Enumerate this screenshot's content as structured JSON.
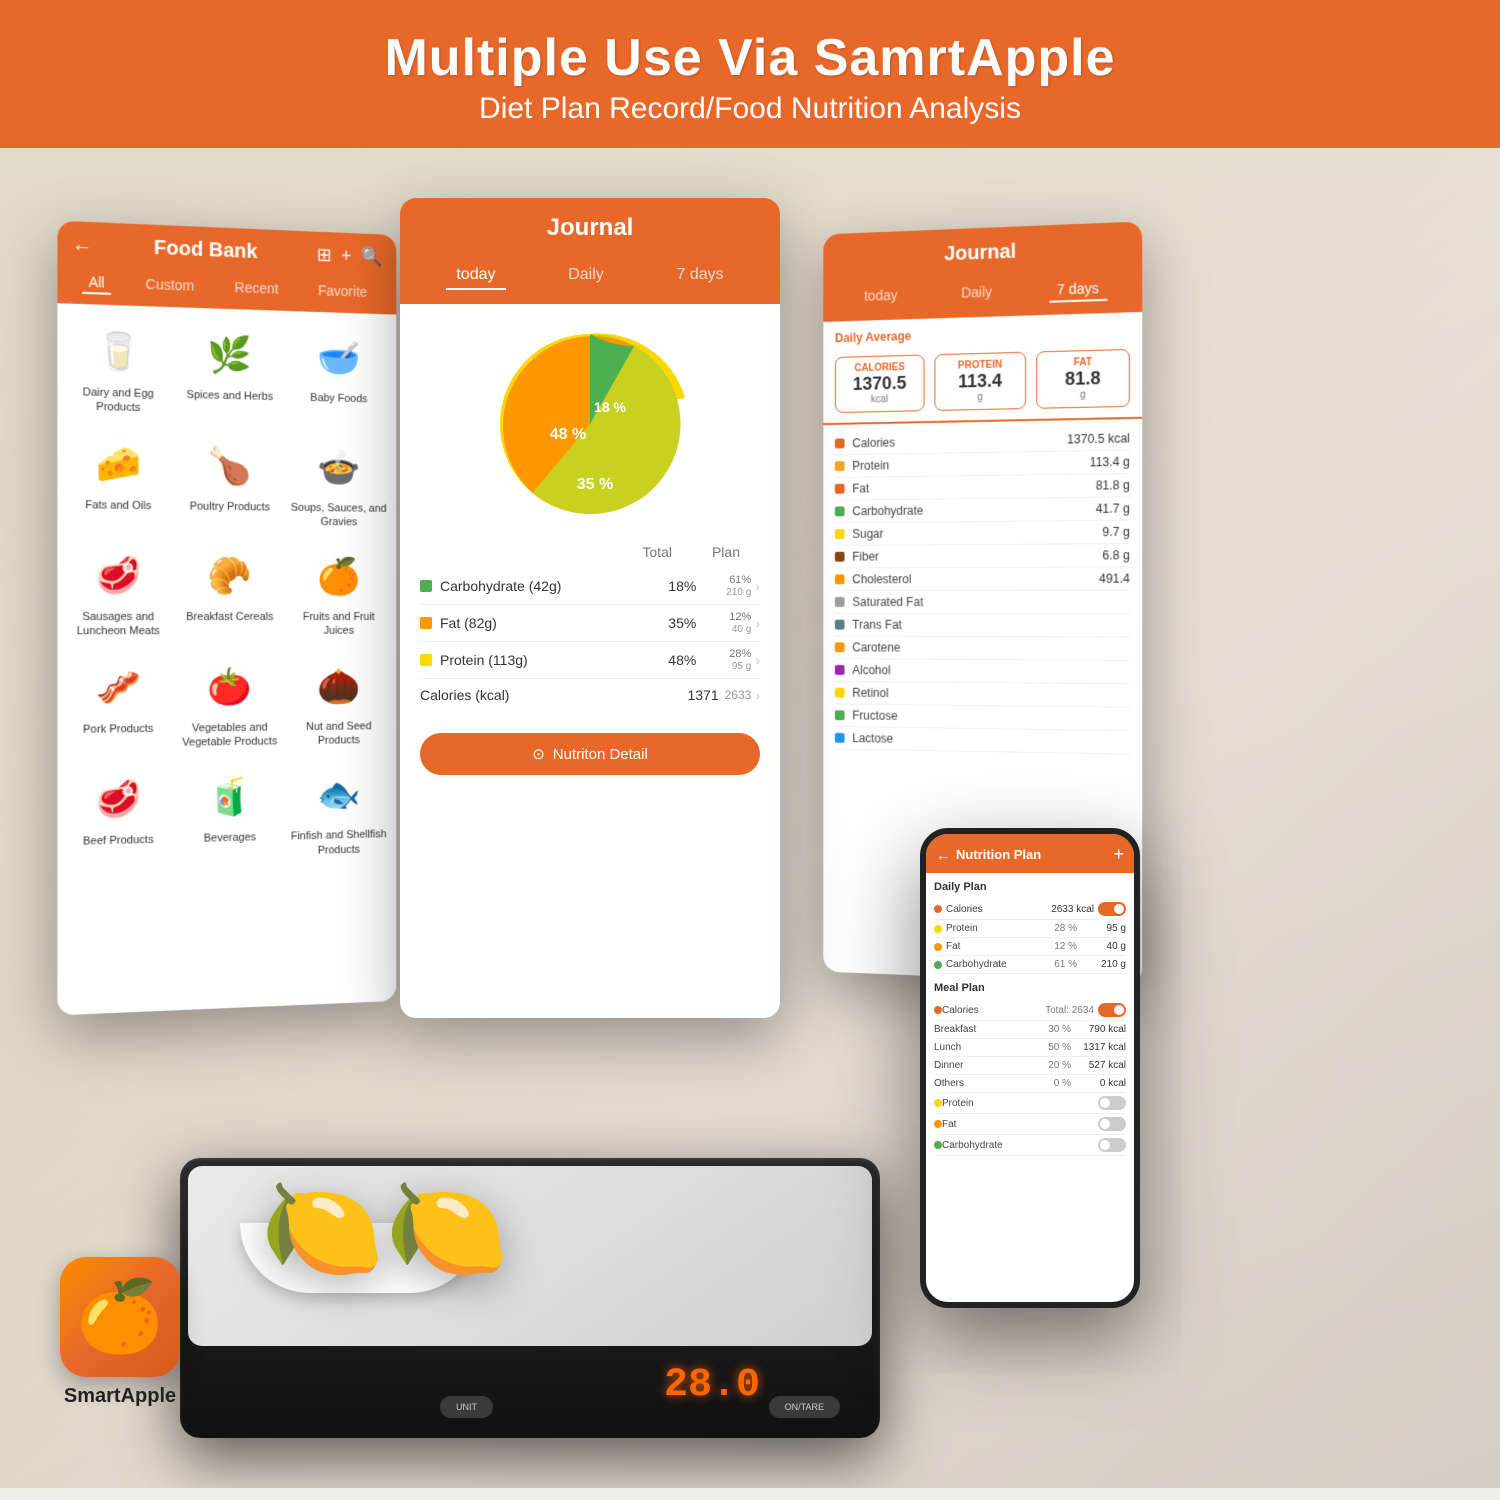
{
  "header": {
    "title": "Multiple Use Via SamrtApple",
    "subtitle": "Diet Plan Record/Food Nutrition Analysis",
    "bg_color": "#e8682a"
  },
  "food_bank": {
    "title": "Food Bank",
    "tabs": [
      "All",
      "Custom",
      "Recent",
      "Favorite"
    ],
    "active_tab": "All",
    "items": [
      {
        "label": "Dairy and Egg Products",
        "icon": "🥛"
      },
      {
        "label": "Spices and Herbs",
        "icon": "🌿"
      },
      {
        "label": "Baby Foods",
        "icon": "🥣"
      },
      {
        "label": "Fats and Oils",
        "icon": "🧀"
      },
      {
        "label": "Poultry Products",
        "icon": "🍗"
      },
      {
        "label": "Soups, Sauces, and Gravies",
        "icon": "🍲"
      },
      {
        "label": "Sausages and Luncheon Meats",
        "icon": "🥩"
      },
      {
        "label": "Breakfast Cereals",
        "icon": "🥐"
      },
      {
        "label": "Fruits and Fruit Juices",
        "icon": "🍊"
      },
      {
        "label": "Pork Products",
        "icon": "🥓"
      },
      {
        "label": "Vegetables and Vegetable Products",
        "icon": "🍅"
      },
      {
        "label": "Nut and Seed Products",
        "icon": "🌰"
      },
      {
        "label": "Beef Products",
        "icon": "🥩"
      },
      {
        "label": "Beverages",
        "icon": "🧃"
      },
      {
        "label": "Finfish and Shellfish Products",
        "icon": "🐟"
      }
    ]
  },
  "journal": {
    "title": "Journal",
    "tabs": [
      "today",
      "Daily",
      "7 days"
    ],
    "active_tab": "today",
    "pie": {
      "carb_pct": 48,
      "fat_pct": 35,
      "protein_pct": 18
    },
    "nutrition_rows": [
      {
        "name": "Carbohydrate (42g)",
        "total": "18%",
        "plan": "61%",
        "plan_val": "210 g",
        "color": "#4caf50"
      },
      {
        "name": "Fat (82g)",
        "total": "35%",
        "plan": "12%",
        "plan_val": "40 g",
        "color": "#ff9800"
      },
      {
        "name": "Protein (113g)",
        "total": "48%",
        "plan": "28%",
        "plan_val": "95 g",
        "color": "#ffd700"
      }
    ],
    "calories_total": "1371",
    "calories_plan": "2633",
    "detail_btn": "Nutriton Detail"
  },
  "journal7": {
    "title": "Journal",
    "tabs": [
      "today",
      "Daily",
      "7 days"
    ],
    "active_tab": "7 days",
    "daily_avg_label": "Daily Average",
    "stats": [
      {
        "label": "CALORIES",
        "value": "1370.5",
        "unit": "kcal"
      },
      {
        "label": "PROTEIN",
        "value": "113.4",
        "unit": "g"
      },
      {
        "label": "FAT",
        "value": "81.8",
        "unit": "g"
      }
    ],
    "nutrients": [
      {
        "name": "Calories",
        "value": "1370.5 kcal",
        "color": "#e8682a"
      },
      {
        "name": "Protein",
        "value": "113.4 g",
        "color": "#f5a623"
      },
      {
        "name": "Fat",
        "value": "81.8 g",
        "color": "#e8682a"
      },
      {
        "name": "Carbohydrate",
        "value": "41.7 g",
        "color": "#4caf50"
      },
      {
        "name": "Sugar",
        "value": "9.7 g",
        "color": "#ffd700"
      },
      {
        "name": "Fiber",
        "value": "6.8 g",
        "color": "#8b4513"
      },
      {
        "name": "Cholesterol",
        "value": "491.4",
        "color": "#ff9800"
      },
      {
        "name": "Saturated Fat",
        "value": "",
        "color": "#9e9e9e"
      },
      {
        "name": "Trans Fat",
        "value": "",
        "color": "#607d8b"
      },
      {
        "name": "Carotene",
        "value": "",
        "color": "#ff9800"
      },
      {
        "name": "Alcohol",
        "value": "",
        "color": "#9c27b0"
      },
      {
        "name": "Retinol",
        "value": "",
        "color": "#ffd700"
      },
      {
        "name": "Fructose",
        "value": "",
        "color": "#4caf50"
      },
      {
        "name": "Lactose",
        "value": "",
        "color": "#2196f3"
      }
    ]
  },
  "nutrition_plan": {
    "title": "Nutrition Plan",
    "daily_plan_label": "Daily Plan",
    "rows": [
      {
        "label": "Calories",
        "pct": "",
        "val": "2633 kcal",
        "color": "#e8682a",
        "toggle": true,
        "toggle_on": true
      },
      {
        "label": "Protein",
        "pct": "28 %",
        "val": "95 g",
        "color": "#ffd700"
      },
      {
        "label": "Fat",
        "pct": "12 %",
        "val": "40 g",
        "color": "#ff9800"
      },
      {
        "label": "Carbohydrate",
        "pct": "61 %",
        "val": "210 g",
        "color": "#4caf50"
      }
    ],
    "meal_plan_label": "Meal Plan",
    "meal_rows": [
      {
        "label": "Calories",
        "sub": "Total: 2634",
        "val": "",
        "toggle": true,
        "toggle_on": true
      },
      {
        "label": "Breakfast",
        "pct": "30 %",
        "val": "790 kcal"
      },
      {
        "label": "Lunch",
        "pct": "50 %",
        "val": "1317 kcal"
      },
      {
        "label": "Dinner",
        "pct": "20 %",
        "val": "527 kcal"
      },
      {
        "label": "Others",
        "pct": "0 %",
        "val": "0 kcal"
      }
    ],
    "macro_rows": [
      {
        "label": "Protein",
        "toggle": false
      },
      {
        "label": "Fat",
        "toggle": false
      },
      {
        "label": "Carbohydrate",
        "toggle": false
      }
    ]
  },
  "scale": {
    "display": "28.0",
    "btn_unit": "UNIT",
    "btn_tare": "ON/TARE"
  },
  "logo": {
    "name": "SmartApple",
    "icon": "🍊"
  }
}
